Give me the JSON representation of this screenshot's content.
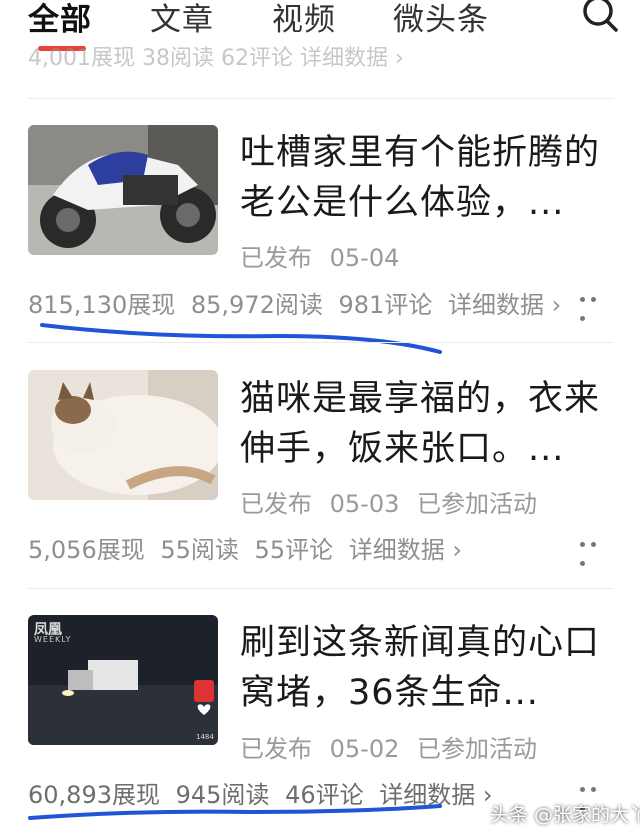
{
  "tabs": [
    {
      "label": "全部",
      "active": true
    },
    {
      "label": "文章",
      "active": false
    },
    {
      "label": "视频",
      "active": false
    },
    {
      "label": "微头条",
      "active": false
    }
  ],
  "icons": {
    "search": "search-icon",
    "more": "more-dots-icon",
    "chevron": "chevron-right-icon"
  },
  "accent_color": "#e8413a",
  "annotation_color": "#1f55d6",
  "partial_stats": "4,001展现   38阅读   62评论   详细数据 ›",
  "articles": [
    {
      "title": "吐槽家里有个能折腾的老公是什么体验，...",
      "status": "已发布",
      "date": "05-04",
      "activity": "",
      "impressions": "815,130展现",
      "reads": "85,972阅读",
      "comments": "981评论",
      "details": "详细数据 ›",
      "thumb_icon": "motorcycle-thumbnail"
    },
    {
      "title": "猫咪是最享福的，衣来伸手，饭来张口。...",
      "status": "已发布",
      "date": "05-03",
      "activity": "已参加活动",
      "impressions": "5,056展现",
      "reads": "55阅读",
      "comments": "55评论",
      "details": "详细数据 ›",
      "thumb_icon": "cat-thumbnail"
    },
    {
      "title": "刷到这条新闻真的心口窝堵，36条生命...",
      "status": "已发布",
      "date": "05-02",
      "activity": "已参加活动",
      "impressions": "60,893展现",
      "reads": "945阅读",
      "comments": "46评论",
      "details": "详细数据 ›",
      "thumb_icon": "night-road-thumbnail",
      "thumb_brand": "凤凰",
      "thumb_brand_sub": "WEEKLY",
      "thumb_count": "1484"
    }
  ],
  "watermark": "头条 @张家的大丫"
}
